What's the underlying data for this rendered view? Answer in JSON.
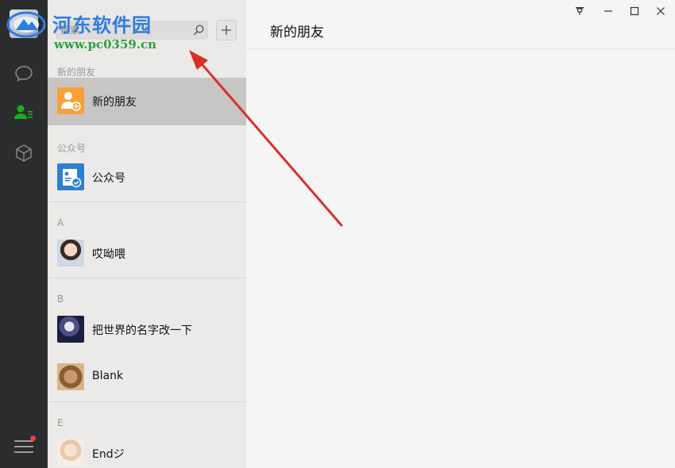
{
  "window": {
    "title": "新的朋友",
    "controls": [
      "pin-icon",
      "minimize-icon",
      "maximize-icon",
      "close-icon"
    ]
  },
  "search": {
    "placeholder": "搜索"
  },
  "list": {
    "sections": [
      {
        "label": "新的朋友",
        "items": [
          {
            "name": "新的朋友",
            "icon": "new-friend-icon",
            "active": true
          }
        ]
      },
      {
        "label": "公众号",
        "items": [
          {
            "name": "公众号",
            "icon": "official-account-icon"
          }
        ]
      },
      {
        "label": "A",
        "items": [
          {
            "name": "哎呦喂"
          }
        ]
      },
      {
        "label": "B",
        "items": [
          {
            "name": "把世界的名字改一下"
          },
          {
            "name": "Blank"
          }
        ]
      },
      {
        "label": "E",
        "items": [
          {
            "name": "Endジ"
          }
        ]
      }
    ]
  },
  "watermark": {
    "site_name": "河东软件园",
    "url": "www.pc0359.cn"
  },
  "colors": {
    "rail": "#2b2c2e",
    "active_nav": "#1aad19",
    "badge": "#e64340",
    "arrow": "#d9302a",
    "new_friend": "#f7a13b",
    "official_account": "#2f7fd0"
  }
}
